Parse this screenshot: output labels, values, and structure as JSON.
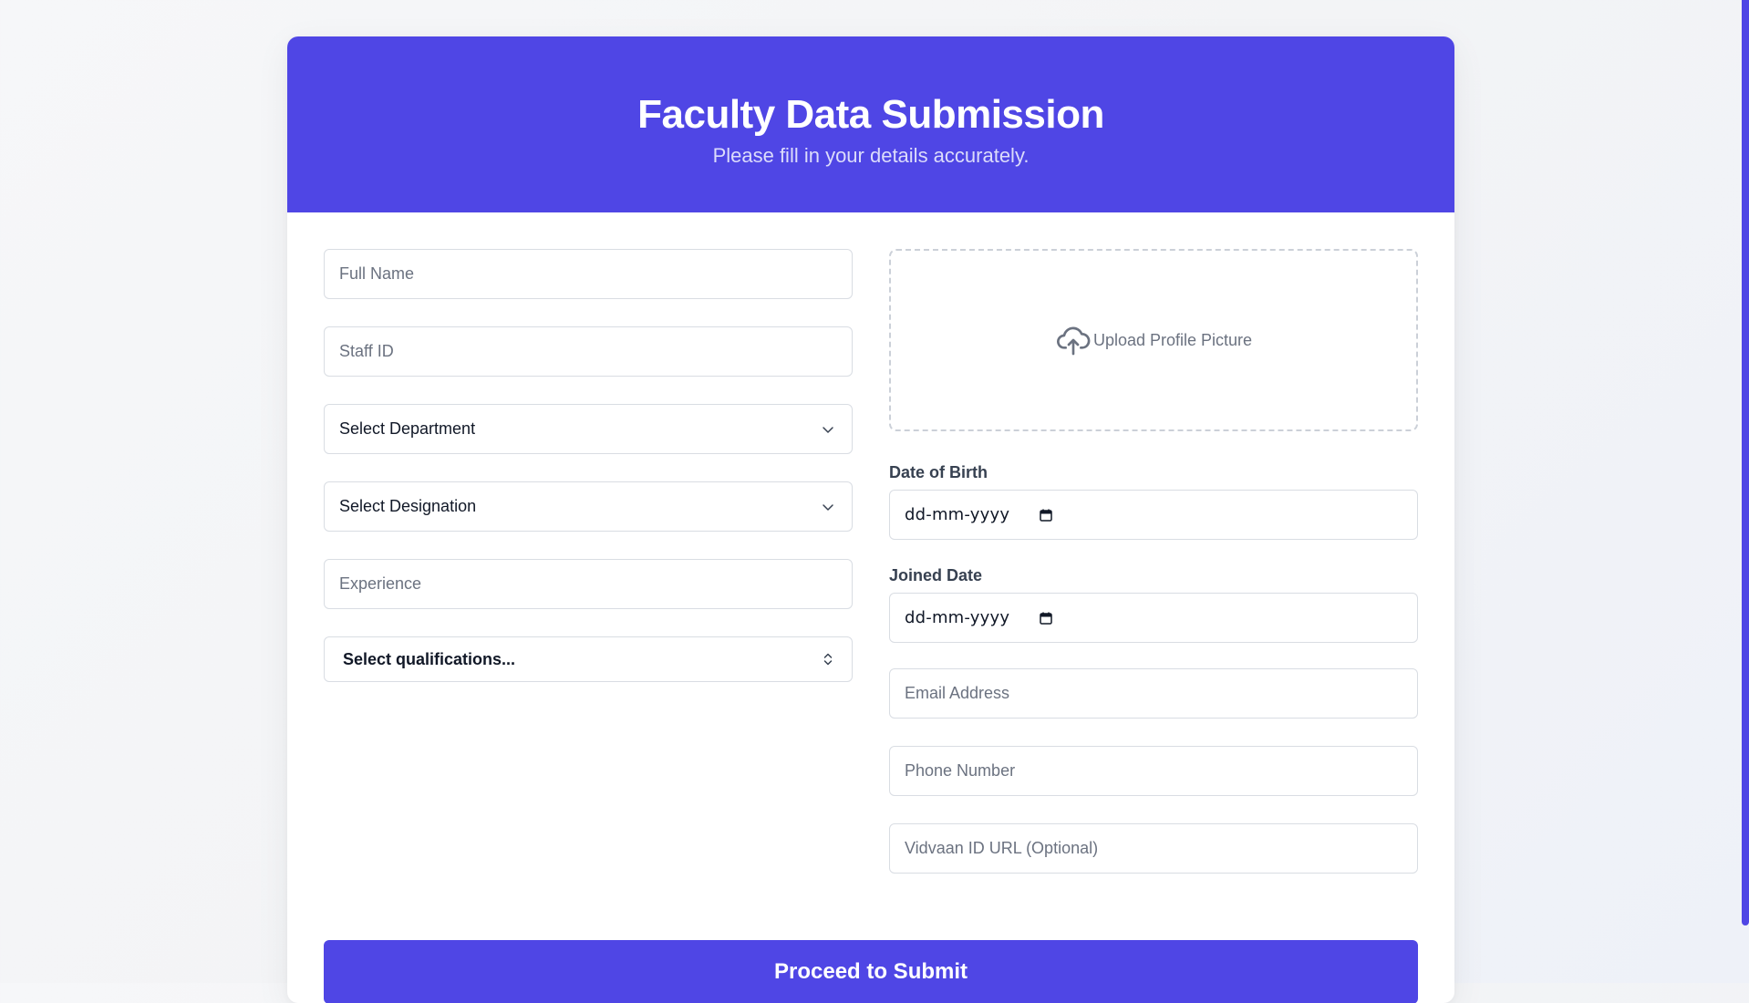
{
  "header": {
    "title": "Faculty Data Submission",
    "subtitle": "Please fill in your details accurately."
  },
  "left": {
    "full_name_placeholder": "Full Name",
    "staff_id_placeholder": "Staff ID",
    "department_select": "Select Department",
    "designation_select": "Select Designation",
    "experience_placeholder": "Experience",
    "qualifications_select": "Select qualifications..."
  },
  "right": {
    "upload_label": "Upload Profile Picture",
    "dob_label": "Date of Birth",
    "dob_value": "dd-mm-yyyy",
    "joined_label": "Joined Date",
    "joined_value": "dd-mm-yyyy",
    "email_placeholder": "Email Address",
    "phone_placeholder": "Phone Number",
    "vidvaan_placeholder": "Vidvaan ID URL (Optional)"
  },
  "submit_label": "Proceed to Submit",
  "colors": {
    "accent": "#4f46e5",
    "input_border": "#d9dde3",
    "placeholder": "#6b7280"
  },
  "icons": {
    "upload": "cloud-upload-icon",
    "select": "chevron-down-icon",
    "multi": "chevron-up-down-icon",
    "date": "calendar-icon"
  }
}
